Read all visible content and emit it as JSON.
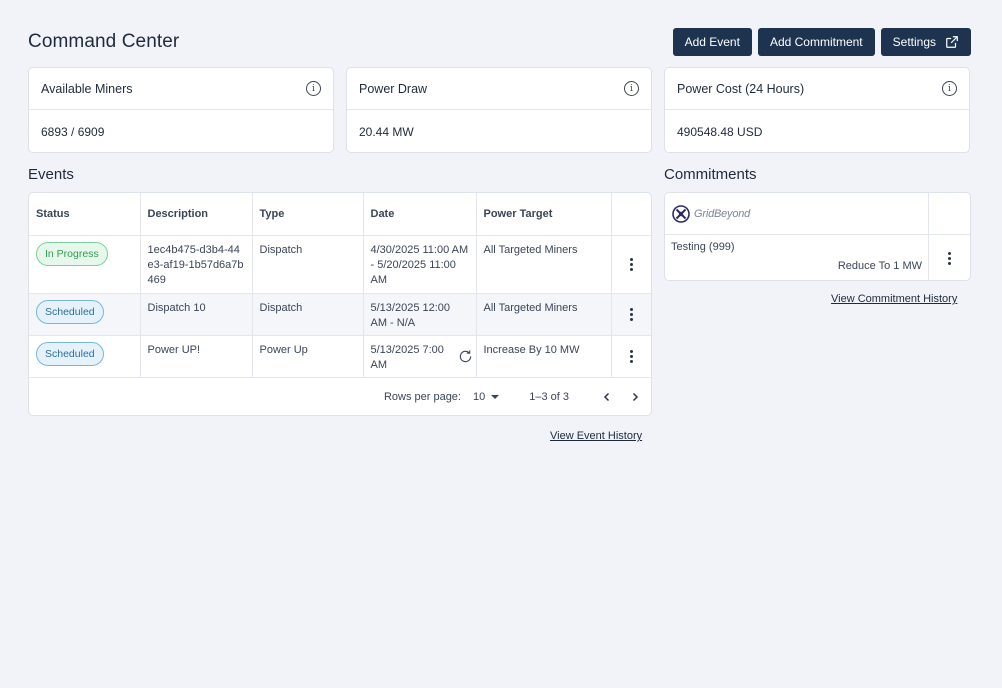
{
  "header": {
    "title": "Command Center",
    "buttons": {
      "add_event": "Add Event",
      "add_commitment": "Add Commitment",
      "settings": "Settings"
    }
  },
  "stats": [
    {
      "title": "Available Miners",
      "value": "6893 / 6909"
    },
    {
      "title": "Power Draw",
      "value": "20.44 MW"
    },
    {
      "title": "Power Cost (24 Hours)",
      "value": "490548.48 USD"
    }
  ],
  "events": {
    "title": "Events",
    "columns": [
      "Status",
      "Description",
      "Type",
      "Date",
      "Power Target"
    ],
    "rows": [
      {
        "status": "In Progress",
        "description": "1ec4b475-d3b4-44e3-af19-1b57d6a7b469",
        "type": "Dispatch",
        "date": "4/30/2025 11:00 AM - 5/20/2025 11:00 AM",
        "power_target": "All Targeted Miners"
      },
      {
        "status": "Scheduled",
        "description": "Dispatch 10",
        "type": "Dispatch",
        "date": "5/13/2025 12:00 AM - N/A",
        "power_target": "All Targeted Miners"
      },
      {
        "status": "Scheduled",
        "description": "Power UP!",
        "type": "Power Up",
        "date": "5/13/2025 7:00 AM",
        "power_target": "Increase By 10 MW"
      }
    ],
    "pagination": {
      "rows_per_page_label": "Rows per page:",
      "rows_per_page": "10",
      "range": "1–3 of 3"
    },
    "history_link": "View Event History"
  },
  "commitments": {
    "title": "Commitments",
    "logo_text": "GridBeyond",
    "rows": [
      {
        "name": "Testing (999)",
        "action": "Reduce To 1 MW"
      }
    ],
    "history_link": "View Commitment History"
  },
  "colors": {
    "background": "#f1f3f9",
    "primary_button": "#1e3350",
    "in_progress": "#2f9c55",
    "scheduled": "#2c6f9f"
  }
}
